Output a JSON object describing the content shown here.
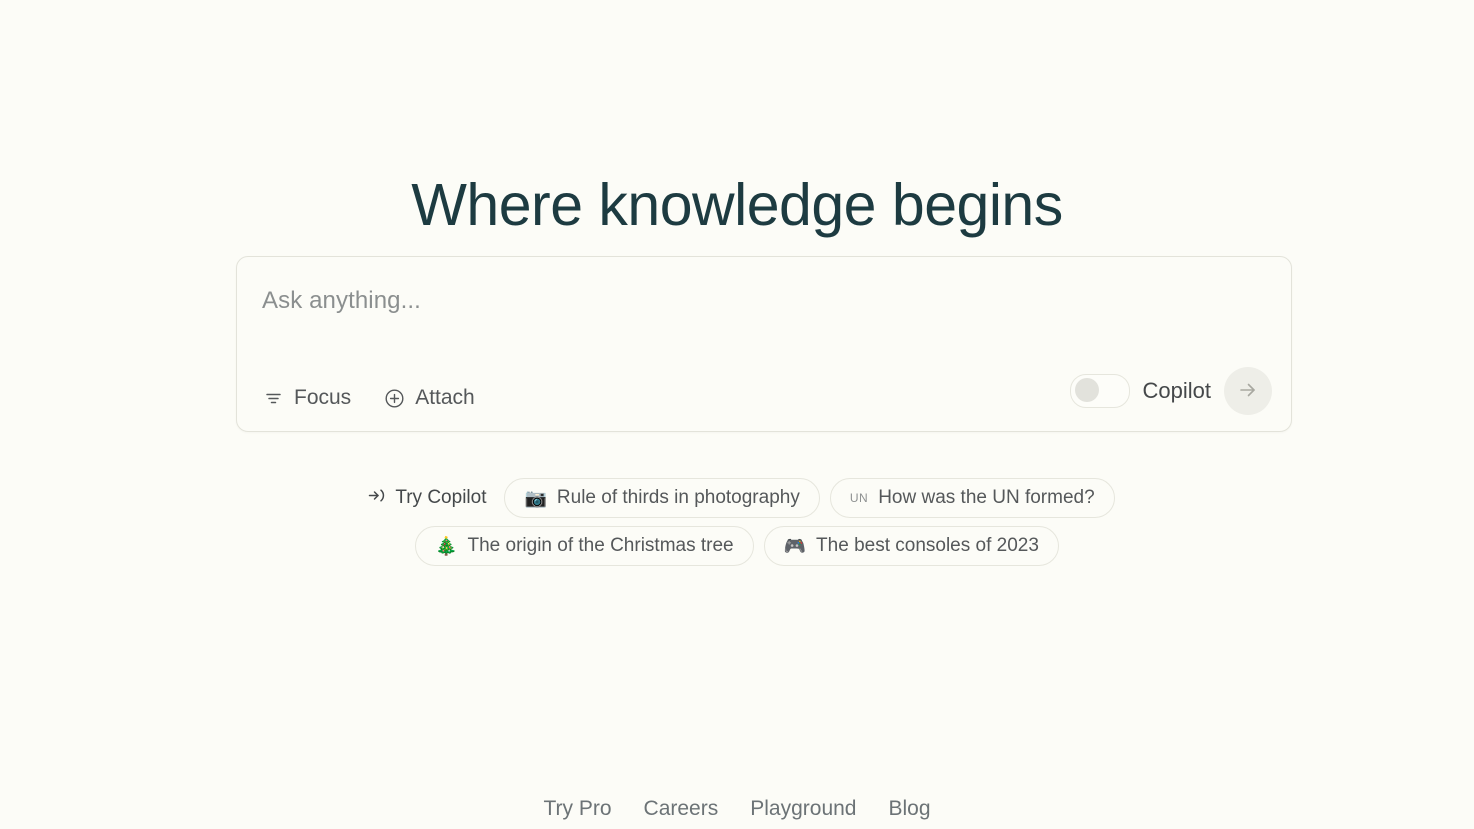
{
  "hero": {
    "title": "Where knowledge begins"
  },
  "search": {
    "placeholder": "Ask anything...",
    "value": "",
    "focus_label": "Focus",
    "focus_icon": "filter-icon",
    "attach_label": "Attach",
    "attach_icon": "plus-circle-icon",
    "copilot_label": "Copilot",
    "copilot_enabled": false,
    "submit_icon": "arrow-right-icon"
  },
  "suggestions": {
    "try_copilot": {
      "label": "Try Copilot",
      "icon": "arrow-into-bracket-icon"
    },
    "rows": [
      [
        {
          "emoji": "📷",
          "icon_name": "camera-emoji",
          "label": "Rule of thirds in photography"
        },
        {
          "emoji": "UN",
          "icon_name": "un-flag-emoji",
          "label": "How was the UN formed?",
          "emoji_is_text": true
        }
      ],
      [
        {
          "emoji": "🎄",
          "icon_name": "christmas-tree-emoji",
          "label": "The origin of the Christmas tree"
        },
        {
          "emoji": "🎮",
          "icon_name": "video-game-controller-emoji",
          "label": "The best consoles of 2023"
        }
      ]
    ]
  },
  "footer": {
    "links": [
      {
        "label": "Try Pro"
      },
      {
        "label": "Careers"
      },
      {
        "label": "Playground"
      },
      {
        "label": "Blog"
      }
    ]
  },
  "colors": {
    "background": "#fcfcf7",
    "heading": "#1d3b41",
    "border": "#e6e6dd",
    "muted_text": "#8b8f8f",
    "body_text": "#55585a"
  }
}
